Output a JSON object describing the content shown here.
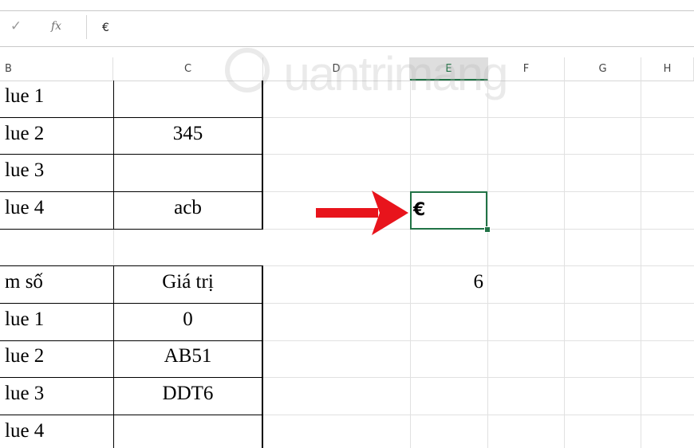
{
  "formula_bar": {
    "check_glyph": "✓",
    "fx_glyph": "fx",
    "value": "€"
  },
  "columns": [
    "B",
    "C",
    "D",
    "E",
    "F",
    "G",
    "H"
  ],
  "active_column": "E",
  "rows": [
    {
      "b": "lue 1",
      "c": ""
    },
    {
      "b": "lue 2",
      "c": "345"
    },
    {
      "b": "lue 3",
      "c": ""
    },
    {
      "b": "lue 4",
      "c": "acb"
    },
    {
      "b": "",
      "c": ""
    },
    {
      "b": "m số",
      "c": "Giá trị"
    },
    {
      "b": "lue 1",
      "c": "0"
    },
    {
      "b": "lue 2",
      "c": "AB51"
    },
    {
      "b": "lue 3",
      "c": "DDT6"
    },
    {
      "b": "lue 4",
      "c": ""
    }
  ],
  "selected_cell": {
    "ref": "E4",
    "value": "€"
  },
  "e6_value": "6",
  "watermark": "Quantrimang",
  "colors": {
    "excel_green": "#217346",
    "arrow_red": "#e8141c",
    "grid_line": "#e1e1e1"
  }
}
